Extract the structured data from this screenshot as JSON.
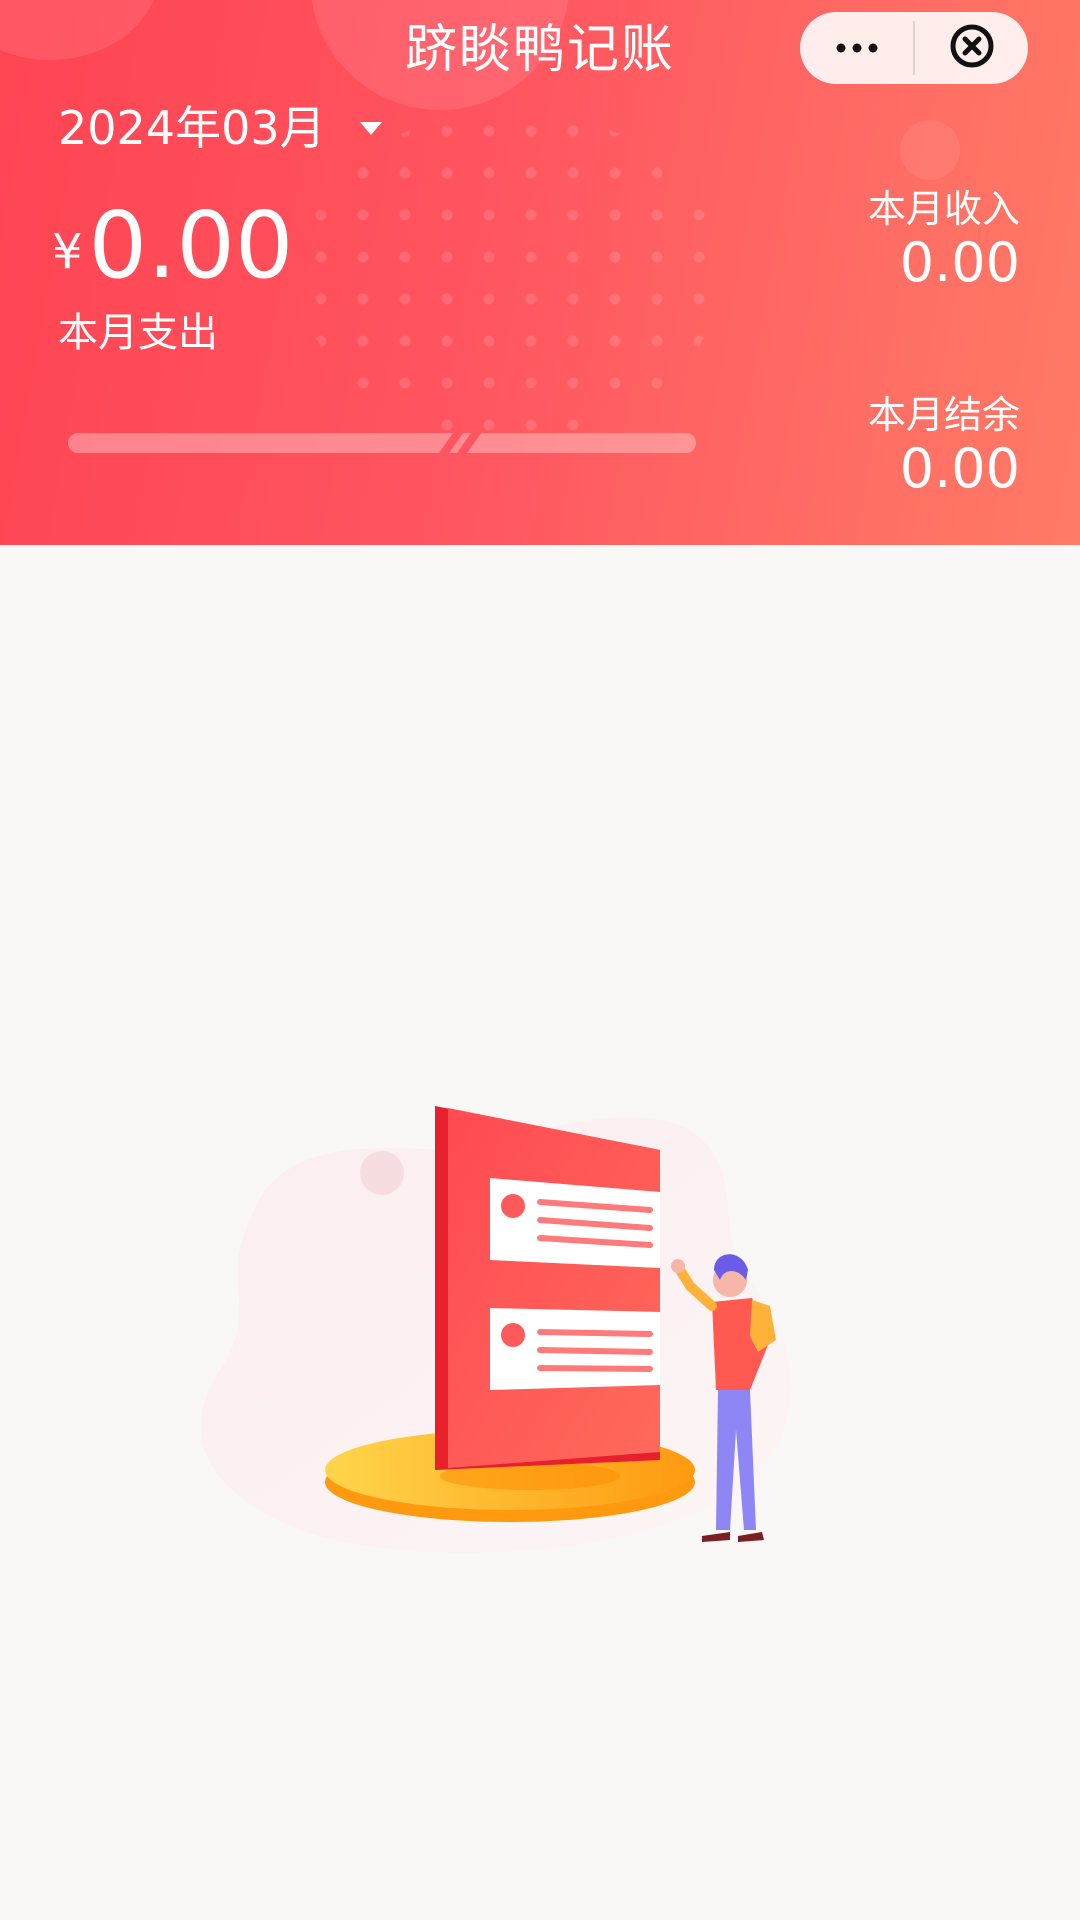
{
  "app": {
    "title": "跻睒鸭记账"
  },
  "capsule": {
    "more_icon": "more-dots-icon",
    "close_icon": "close-circle-icon"
  },
  "summary": {
    "month": "2024年03月",
    "currency_symbol": "¥",
    "expense_amount": "0.00",
    "expense_label": "本月支出",
    "income_label": "本月收入",
    "income_amount": "0.00",
    "balance_label": "本月结余",
    "balance_amount": "0.00"
  },
  "colors": {
    "header_start": "#ff4452",
    "header_end": "#ff7a66",
    "background": "#faf8f6"
  },
  "empty_state": {
    "illustration": "empty-records-illustration"
  }
}
